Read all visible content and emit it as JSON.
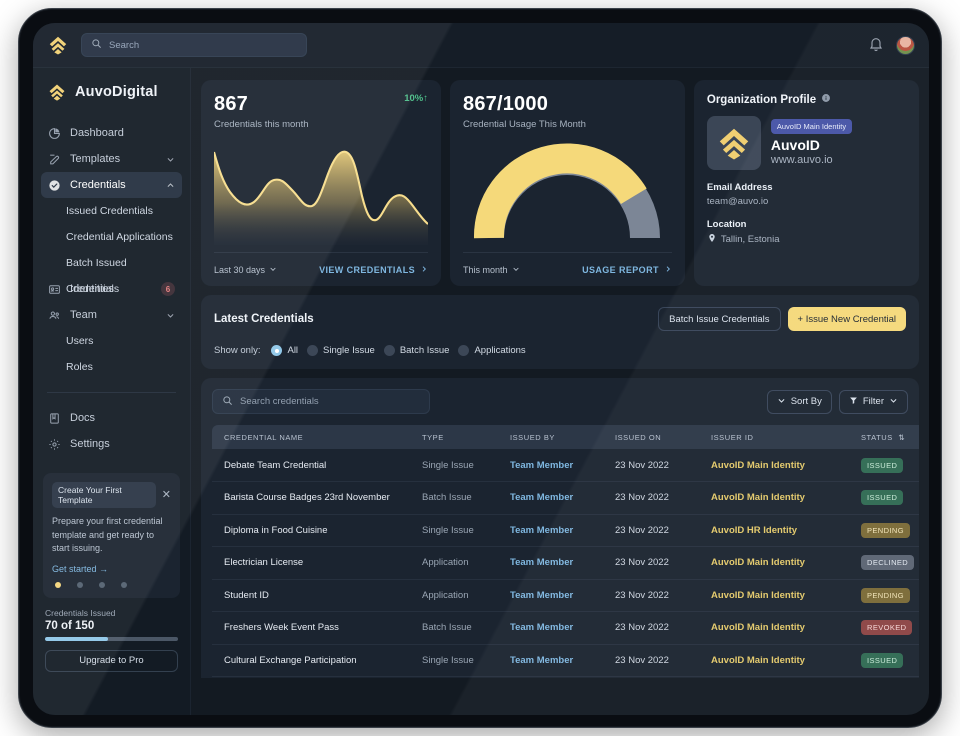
{
  "topbar": {
    "logo_icon": "auvo-chevron-logo",
    "search_placeholder": "Search",
    "search_icon": "search-icon",
    "bell_icon": "bell-icon",
    "avatar": "user-avatar"
  },
  "sidebar": {
    "brand": "AuvoDigital",
    "items": [
      {
        "label": "Dashboard",
        "icon": "pie-chart-icon",
        "active": false,
        "chevron": "",
        "badge": ""
      },
      {
        "label": "Templates",
        "icon": "template-pen-icon",
        "active": false,
        "chevron": "down",
        "badge": ""
      },
      {
        "label": "Credentials",
        "icon": "badge-check-icon",
        "active": true,
        "chevron": "up",
        "badge": ""
      },
      {
        "label": "Identities",
        "icon": "id-card-icon",
        "active": false,
        "chevron": "",
        "badge": "6"
      },
      {
        "label": "Team",
        "icon": "people-icon",
        "active": false,
        "chevron": "down",
        "badge": ""
      }
    ],
    "credentials_sub": [
      "Issued Credentials",
      "Credential Applications",
      "Batch Issued Credentials"
    ],
    "team_sub": [
      "Users",
      "Roles"
    ],
    "bottom_items": [
      {
        "label": "Docs",
        "icon": "book-icon"
      },
      {
        "label": "Settings",
        "icon": "gear-icon"
      }
    ],
    "promo": {
      "pill": "Create Your First Template",
      "close_icon": "close-icon",
      "body": "Prepare your first credential template and get ready to start issuing.",
      "cta": "Get started  →",
      "dots": 4,
      "active_dot": 0
    },
    "usage": {
      "caption": "Credentials Issued",
      "value": "70 of 150",
      "percent": 47,
      "bar_color": "#8fc7e8"
    },
    "upgrade_label": "Upgrade to Pro"
  },
  "cards": {
    "credentials_month": {
      "value": "867",
      "caption": "Credentials this month",
      "delta": "10%↑",
      "delta_color": "#4fbf8b",
      "range_label": "Last 30 days",
      "link_label": "VIEW CREDENTIALS"
    },
    "usage_month": {
      "value": "867/1000",
      "caption": "Credential Usage This Month",
      "range_label": "This month",
      "link_label": "USAGE REPORT"
    },
    "organization": {
      "title": "Organization Profile",
      "info_icon": "info-icon",
      "logo_icon": "auvo-chevron-logo",
      "identity_pill": "AuvoID Main Identity",
      "name": "AuvoID",
      "url": "www.auvo.io",
      "email_label": "Email Address",
      "email_value": "team@auvo.io",
      "location_label": "Location",
      "location_icon": "map-pin-icon",
      "location_value": "Tallin, Estonia"
    }
  },
  "latest": {
    "title": "Latest Credentials",
    "batch_button": "Batch Issue Credentials",
    "issue_button": "+ Issue New Credential",
    "filter_label": "Show only:",
    "filters": [
      {
        "label": "All",
        "selected": true
      },
      {
        "label": "Single Issue",
        "selected": false
      },
      {
        "label": "Batch Issue",
        "selected": false
      },
      {
        "label": "Applications",
        "selected": false
      }
    ]
  },
  "table": {
    "search_placeholder": "Search credentials",
    "search_icon": "search-icon",
    "sort_label": "Sort By",
    "filter_label": "Filter",
    "columns": [
      "CREDENTIAL NAME",
      "TYPE",
      "ISSUED BY",
      "ISSUED ON",
      "ISSUER ID",
      "STATUS"
    ],
    "status_sort_icon": "sort-updown-icon",
    "rows": [
      {
        "name": "Debate Team Credential",
        "type": "Single Issue",
        "issued_by": "Team Member",
        "issued_on": "23 Nov 2022",
        "issuer_id": "AuvoID Main Identity",
        "status": "ISSUED"
      },
      {
        "name": "Barista Course Badges 23rd November",
        "type": "Batch Issue",
        "issued_by": "Team Member",
        "issued_on": "23 Nov 2022",
        "issuer_id": "AuvoID Main Identity",
        "status": "ISSUED"
      },
      {
        "name": "Diploma in Food Cuisine",
        "type": "Single Issue",
        "issued_by": "Team Member",
        "issued_on": "23 Nov 2022",
        "issuer_id": "AuvoID HR Identity",
        "status": "PENDING"
      },
      {
        "name": "Electrician License",
        "type": "Application",
        "issued_by": "Team Member",
        "issued_on": "23 Nov 2022",
        "issuer_id": "AuvoID Main Identity",
        "status": "DECLINED"
      },
      {
        "name": "Student ID",
        "type": "Application",
        "issued_by": "Team Member",
        "issued_on": "23 Nov 2022",
        "issuer_id": "AuvoID Main Identity",
        "status": "PENDING"
      },
      {
        "name": "Freshers Week Event Pass",
        "type": "Batch Issue",
        "issued_by": "Team Member",
        "issued_on": "23 Nov 2022",
        "issuer_id": "AuvoID Main Identity",
        "status": "REVOKED"
      },
      {
        "name": "Cultural Exchange Participation",
        "type": "Single Issue",
        "issued_by": "Team Member",
        "issued_on": "23 Nov 2022",
        "issuer_id": "AuvoID Main Identity",
        "status": "ISSUED"
      }
    ],
    "row_menu_icon": "kebab-menu-icon"
  },
  "chart_data": [
    {
      "type": "area",
      "title": "Credentials this month",
      "id": "credentials-sparkline",
      "x": [
        0,
        1,
        2,
        3,
        4,
        5,
        6,
        7,
        8,
        9,
        10,
        11,
        12,
        13,
        14,
        15,
        16
      ],
      "values": [
        92,
        62,
        45,
        40,
        52,
        60,
        57,
        40,
        33,
        58,
        92,
        98,
        60,
        24,
        28,
        48,
        52,
        40
      ],
      "ylim": [
        0,
        100
      ],
      "grid": false,
      "line_color": "#f5d97a",
      "fill": "gradient yellow to transparent"
    },
    {
      "type": "pie",
      "subtype": "semicircle-gauge",
      "title": "Credential Usage This Month",
      "id": "usage-gauge",
      "labels": [
        "Used",
        "Remaining"
      ],
      "values": [
        867,
        133
      ],
      "total": 1000,
      "percent_used": 86.7,
      "colors": [
        "#f5d97a",
        "#7c8696"
      ]
    }
  ]
}
